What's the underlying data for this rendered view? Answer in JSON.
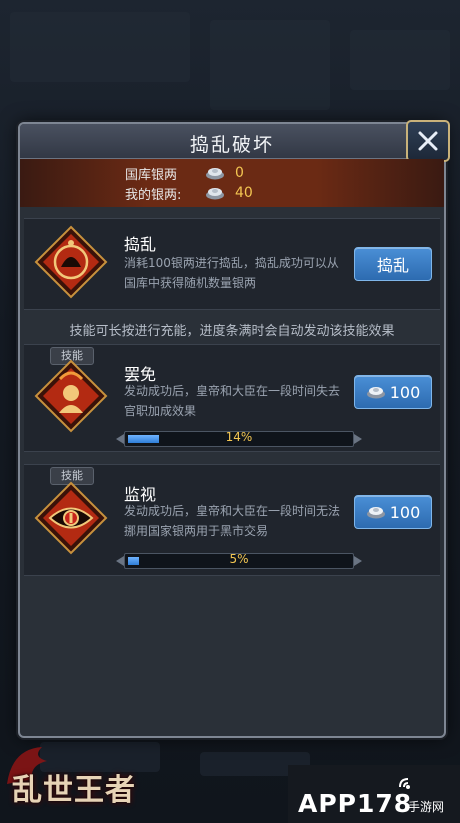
{
  "dialog": {
    "title": "捣乱破坏",
    "close_icon": "close-x-icon"
  },
  "silver": {
    "treasury_label": "国库银两",
    "treasury_value": "0",
    "mine_label": "我的银两:",
    "mine_value": "40"
  },
  "disrupt": {
    "name": "捣乱",
    "desc": "消耗100银两进行捣乱，捣乱成功可以从国库中获得随机数量银两",
    "button": "捣乱"
  },
  "tip": "技能可长按进行充能，进度条满时会自动发动该技能效果",
  "skills": [
    {
      "tag": "技能",
      "name": "罢免",
      "desc": "发动成功后，皇帝和大臣在一段时间失去官职加成效果",
      "cost": "100",
      "progress": 0.14,
      "progress_text": "14%"
    },
    {
      "tag": "技能",
      "name": "监视",
      "desc": "发动成功后，皇帝和大臣在一段时间无法挪用国家银两用于黑市交易",
      "cost": "100",
      "progress": 0.05,
      "progress_text": "5%"
    }
  ],
  "logos": {
    "game": "乱世王者",
    "site": "APP178",
    "site_sub": "手游网"
  },
  "colors": {
    "accent_gold": "#f3c652",
    "button_blue": "#2d6bb0",
    "banner_red": "#6b2a14"
  }
}
